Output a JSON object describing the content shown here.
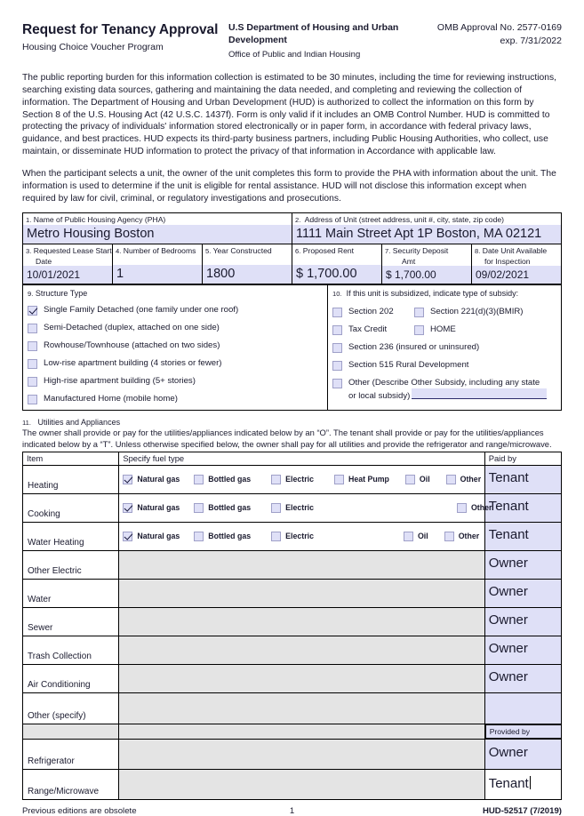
{
  "header": {
    "title": "Request for Tenancy Approval",
    "subtitle": "Housing Choice Voucher Program",
    "department": "U.S Department of Housing and Urban Development",
    "office": "Office of Public and Indian Housing",
    "omb_approval": "OMB Approval No. 2577-0169",
    "omb_exp": "exp. 7/31/2022"
  },
  "paragraphs": {
    "burden": "The public reporting burden for this information collection is estimated to be 30 minutes, including the time for reviewing instructions, searching existing data sources, gathering and maintaining the data needed, and completing and reviewing the collection of information. The Department of Housing and Urban Development (HUD) is authorized to collect the information on this form by Section 8 of the U.S. Housing Act (42 U.S.C. 1437f). Form is only valid if it includes an OMB Control Number. HUD is committed to protecting the privacy of individuals' information stored electronically or in paper form, in accordance with federal privacy laws, guidance, and best practices. HUD expects its third-party business partners, including Public Housing Authorities, who collect, use maintain, or disseminate HUD information to protect the privacy of that information in Accordance with applicable law.",
    "purpose": "When the participant selects a unit, the owner of the unit completes this form to provide the PHA with information about the unit. The information is used to determine if the unit is eligible for rental assistance. HUD will not disclose this information except when required by law for civil, criminal, or regulatory investigations and prosecutions."
  },
  "fields": {
    "pha": {
      "num": "1.",
      "label": "Name of Public Housing Agency (PHA)",
      "value": "Metro Housing Boston"
    },
    "address": {
      "num": "2.",
      "label": "Address of Unit (street address, unit #, city, state, zip code)",
      "value": "1111 Main Street Apt 1P Boston, MA 02121"
    },
    "lease_start": {
      "num": "3.",
      "label": "Requested Lease Start",
      "label2": "Date",
      "value": "10/01/2021"
    },
    "bedrooms": {
      "num": "4.",
      "label": "Number of Bedrooms",
      "value": "1"
    },
    "year_constructed": {
      "num": "5.",
      "label": "Year Constructed",
      "value": "1800"
    },
    "proposed_rent": {
      "num": "6.",
      "label": "Proposed Rent",
      "value": "$ 1,700.00"
    },
    "security_deposit": {
      "num": "7.",
      "label": "Security Deposit",
      "label2": "Amt",
      "value": "$ 1,700.00"
    },
    "date_available": {
      "num": "8.",
      "label": "Date Unit Available",
      "label2": "for Inspection",
      "value": "09/02/2021"
    }
  },
  "structure_type": {
    "num": "9.",
    "title": "Structure Type",
    "options": [
      {
        "label": "Single Family Detached (one family under one roof)",
        "checked": true
      },
      {
        "label": "Semi-Detached (duplex, attached on one side)",
        "checked": false
      },
      {
        "label": "Rowhouse/Townhouse (attached on two sides)",
        "checked": false
      },
      {
        "label": "Low-rise apartment building (4 stories or fewer)",
        "checked": false
      },
      {
        "label": "High-rise apartment building (5+ stories)",
        "checked": false
      },
      {
        "label": "Manufactured Home (mobile home)",
        "checked": false
      }
    ]
  },
  "subsidy": {
    "num": "10.",
    "title": "If this unit is subsidized, indicate type of subsidy:",
    "row1": [
      {
        "label": "Section 202",
        "checked": false
      },
      {
        "label": "Section 221(d)(3)(BMIR)",
        "checked": false
      }
    ],
    "row2": [
      {
        "label": "Tax Credit",
        "checked": false
      },
      {
        "label": "HOME",
        "checked": false
      }
    ],
    "single": [
      {
        "label": "Section 236 (insured or uninsured)",
        "checked": false
      },
      {
        "label": "Section 515 Rural Development",
        "checked": false
      }
    ],
    "other": {
      "line1": "Other (Describe Other Subsidy, including any state",
      "line2": "or local subsidy)",
      "checked": false,
      "value": ""
    }
  },
  "utilities": {
    "num": "11.",
    "title": "Utilities and Appliances",
    "instructions": "The owner shall provide or pay for the utilities/appliances indicated below by an “O”. The tenant shall provide or pay for the utilities/appliances indicated below by a “T”. Unless otherwise specified below, the owner shall pay for all utilities and provide the refrigerator and range/microwave.",
    "columns": {
      "item": "Item",
      "fuel": "Specify fuel type",
      "paid": "Paid by",
      "provided": "Provided by"
    },
    "rows": [
      {
        "item": "Heating",
        "fuels": [
          {
            "label": "Natural gas",
            "checked": true
          },
          {
            "label": "Bottled gas",
            "checked": false
          },
          {
            "label": "Electric",
            "checked": false
          },
          {
            "label": "Heat Pump",
            "checked": false
          },
          {
            "label": "Oil",
            "checked": false
          },
          {
            "label": "Other",
            "checked": false
          }
        ],
        "paid_by": "Tenant"
      },
      {
        "item": "Cooking",
        "fuels": [
          {
            "label": "Natural gas",
            "checked": true
          },
          {
            "label": "Bottled gas",
            "checked": false
          },
          {
            "label": "Electric",
            "checked": false
          },
          {
            "label": "Other",
            "checked": false
          }
        ],
        "paid_by": "Tenant"
      },
      {
        "item": "Water Heating",
        "fuels": [
          {
            "label": "Natural gas",
            "checked": true
          },
          {
            "label": "Bottled gas",
            "checked": false
          },
          {
            "label": "Electric",
            "checked": false
          },
          {
            "label": "Oil",
            "checked": false
          },
          {
            "label": "Other",
            "checked": false
          }
        ],
        "paid_by": "Tenant"
      },
      {
        "item": "Other Electric",
        "fuels": [],
        "paid_by": "Owner"
      },
      {
        "item": "Water",
        "fuels": [],
        "paid_by": "Owner"
      },
      {
        "item": "Sewer",
        "fuels": [],
        "paid_by": "Owner"
      },
      {
        "item": "Trash Collection",
        "fuels": [],
        "paid_by": "Owner"
      },
      {
        "item": "Air Conditioning",
        "fuels": [],
        "paid_by": "Owner"
      },
      {
        "item": "Other (specify)",
        "fuels": [],
        "paid_by": ""
      }
    ],
    "appliance_rows": [
      {
        "item": "Refrigerator",
        "provided_by": "Owner",
        "focused": false
      },
      {
        "item": "Range/Microwave",
        "provided_by": "Tenant",
        "focused": true
      }
    ]
  },
  "footer": {
    "left": "Previous editions are obsolete",
    "page": "1",
    "right": "HUD-52517 (7/2019)"
  }
}
